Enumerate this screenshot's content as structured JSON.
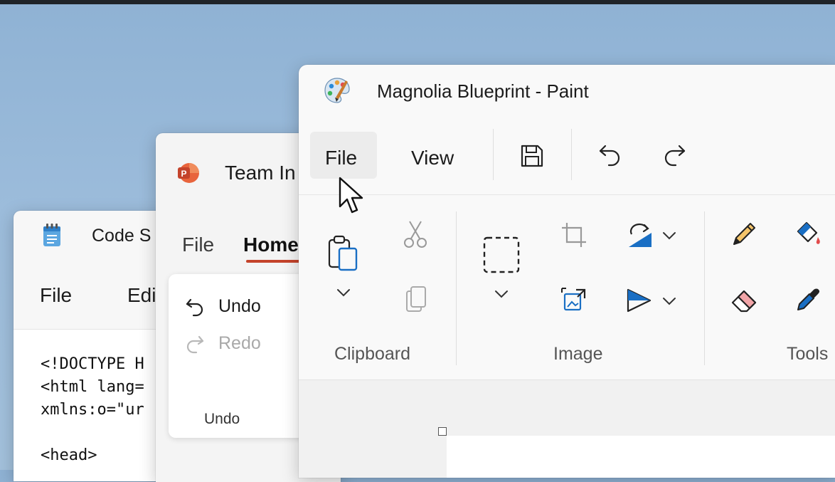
{
  "notepad": {
    "title": "Code S",
    "menu": [
      "File",
      "Edi"
    ],
    "code_lines": [
      "<!DOCTYPE H",
      "<html lang=",
      "xmlns:o=\"ur",
      "",
      "<head>"
    ]
  },
  "powerpoint": {
    "title": "Team In",
    "tabs": [
      "File",
      "Home"
    ],
    "undo_label": "Undo",
    "redo_label": "Redo",
    "group_label": "Undo"
  },
  "paint": {
    "title": "Magnolia Blueprint - Paint",
    "menu": [
      "File",
      "View"
    ],
    "groups": [
      "Clipboard",
      "Image",
      "Tools"
    ]
  },
  "colors": {
    "accent_blue": "#1a6fc4",
    "ppt_orange": "#c4432b"
  }
}
